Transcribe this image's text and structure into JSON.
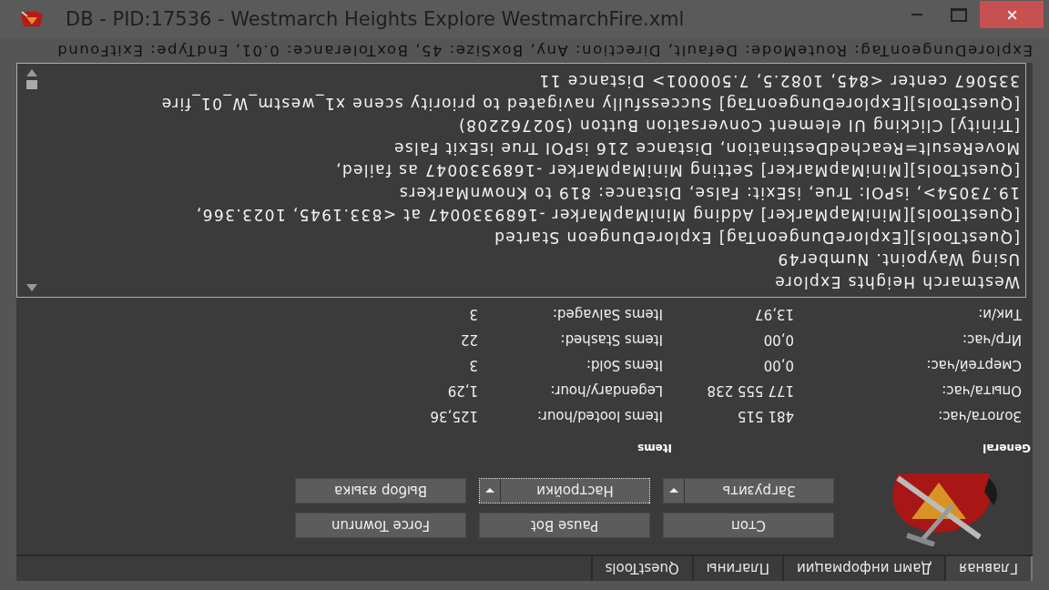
{
  "window": {
    "title": "DB - PID:17536 - Westmarch Heights Explore WestmarchFire.xml"
  },
  "tabs": [
    {
      "label": "Главная",
      "selected": true
    },
    {
      "label": "Дамп информации",
      "selected": false
    },
    {
      "label": "Плагины",
      "selected": false
    },
    {
      "label": "QuestTools",
      "selected": false
    }
  ],
  "buttons": [
    {
      "label": "Стоп",
      "kind": "plain",
      "focused": false
    },
    {
      "label": "Pause Bot",
      "kind": "plain",
      "focused": false
    },
    {
      "label": "Force Townrun",
      "kind": "plain",
      "focused": false
    },
    {
      "label": "Загрузить",
      "kind": "dropdown",
      "focused": false
    },
    {
      "label": "Настройки",
      "kind": "dropdown",
      "focused": true
    },
    {
      "label": "Выбор языка",
      "kind": "plain",
      "focused": false
    }
  ],
  "stats": {
    "headers": [
      "General",
      "Items"
    ],
    "rows": [
      {
        "label": "Золота/час:",
        "value": "481 515",
        "label_2": "Items looted/hour:",
        "value_2": "125,36"
      },
      {
        "label": "Опыта/час:",
        "value": "177 555 238",
        "label_2": "Legendary/hour:",
        "value_2": "1,29"
      },
      {
        "label": "Смертей/час:",
        "value": "0,00",
        "label_2": "Items Sold:",
        "value_2": "3"
      },
      {
        "label": "Игр/час:",
        "value": "0,00",
        "label_2": "Items Stashed:",
        "value_2": "22"
      },
      {
        "label": "Тик/и:",
        "value": "13,97",
        "label_2": "Items Salvaged:",
        "value_2": "3"
      }
    ]
  },
  "log": [
    "Westmarch Heights Explore",
    "Using Waypoint. Number49",
    "[QuestTools][ExploreDungeonTag] ExploreDungeon Started",
    "[QuestTools][MiniMapMarker] Adding MiniMapMarker -1689330047 at <833.1945, 1023.366,",
    "19.73054>, isPOI: True, isExit: False, Distance: 819 to KnownMarkers",
    "[QuestTools][MiniMapMarker] Setting MiniMapMarker -1689330047 as failed,",
    "MoveResult=ReachedDestination, Distance 216 isPOI True isExit False",
    "[Trinity] Clicking UI element Conversation Button (502762208)",
    "[QuestTools][ExploreDungeonTag] Successfully navigated to priority scene x1_westm_W_01_fire",
    "335067 center <845, 1082.5, 7.500001> Distance 11"
  ],
  "status_bar": "ExploreDungeonTag: RouteMode: Default, Direction: Any, BoxSize: 45, BoxTolerance: 0.01, EndType: ExitFound"
}
